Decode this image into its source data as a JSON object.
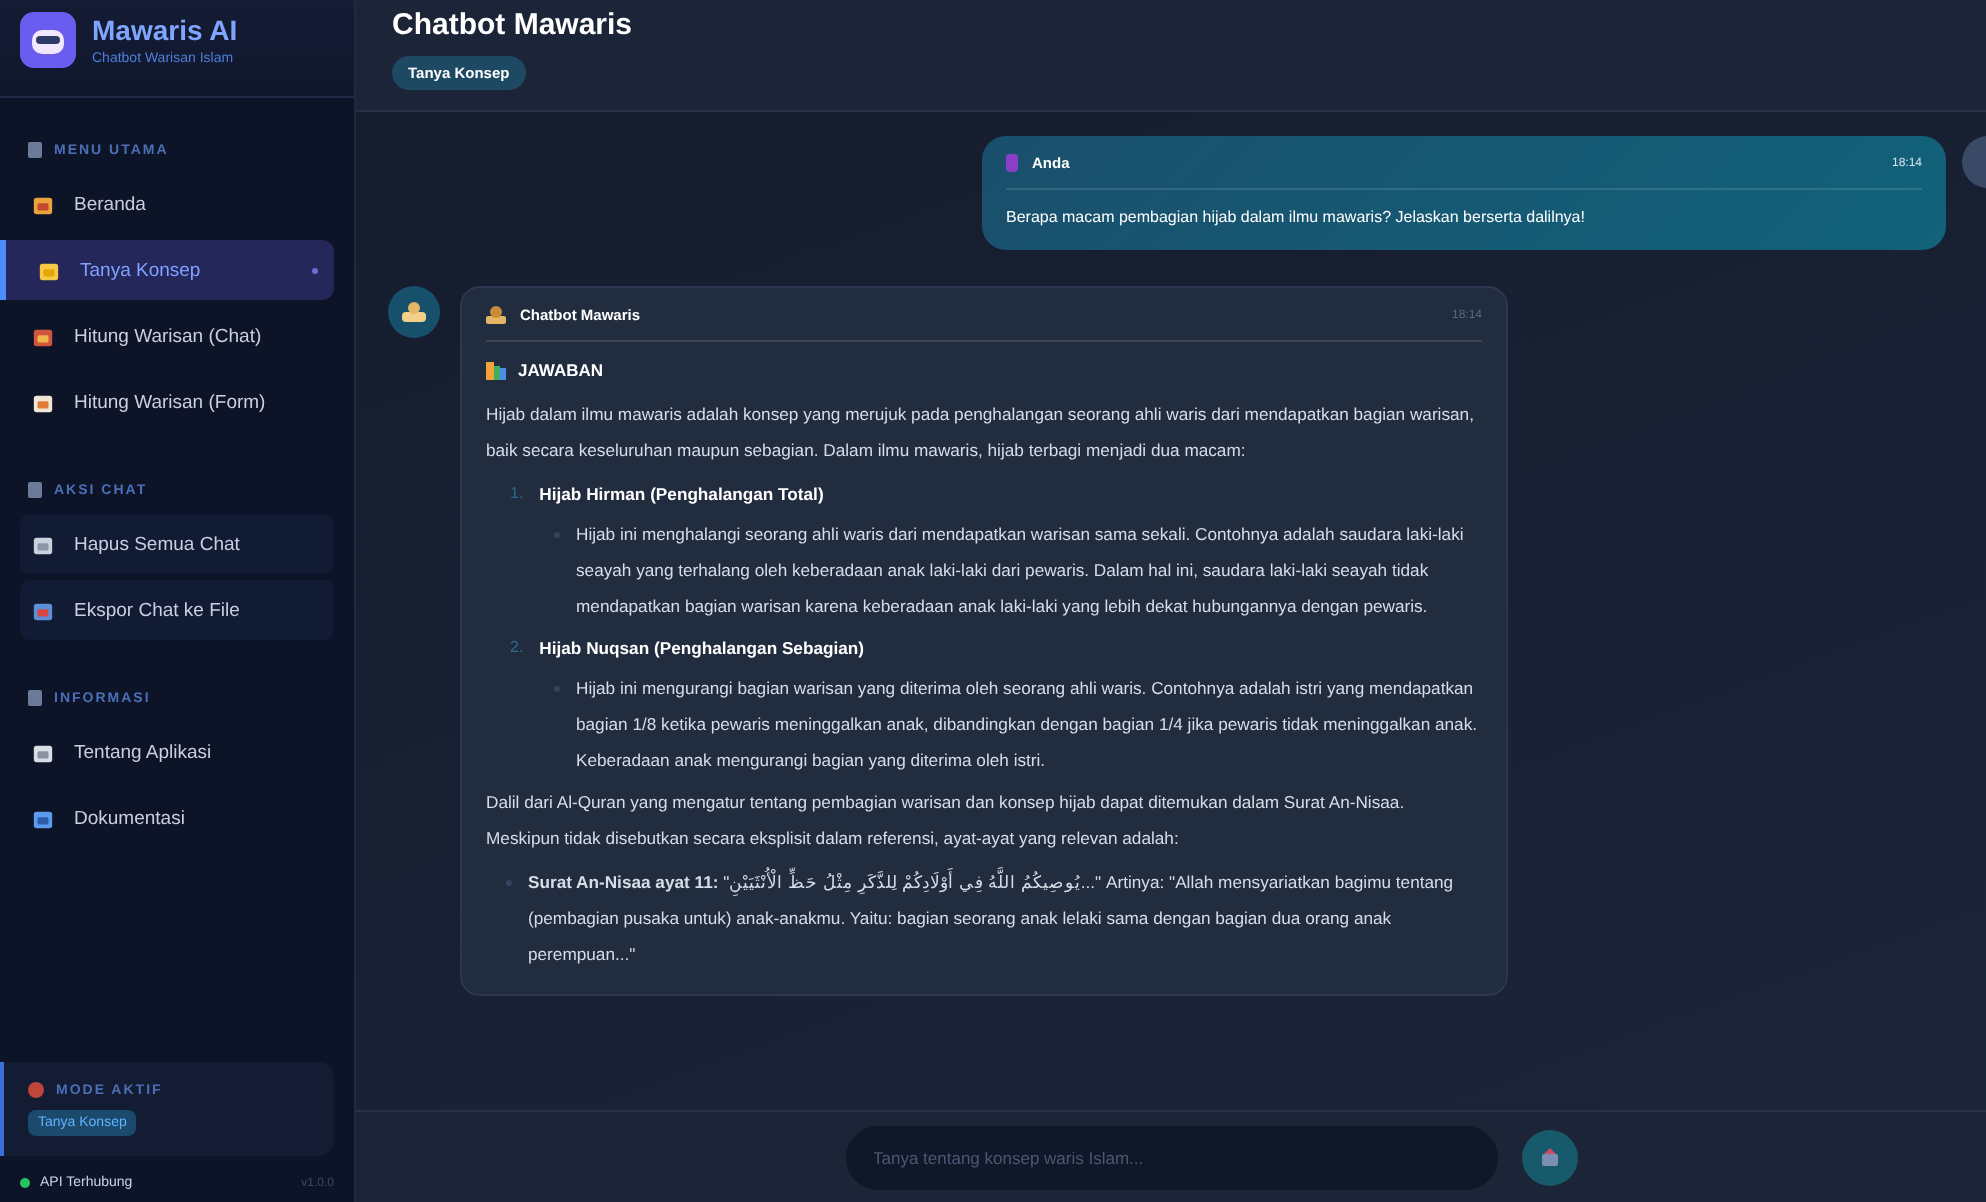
{
  "sidebar": {
    "app_name": "Mawaris AI",
    "app_subtitle": "Chatbot Warisan Islam",
    "sections": [
      {
        "title": "MENU UTAMA",
        "kind": "nav",
        "items": [
          {
            "label": "Beranda",
            "selected": false
          },
          {
            "label": "Tanya Konsep",
            "selected": true
          },
          {
            "label": "Hitung Warisan (Chat)",
            "selected": false
          },
          {
            "label": "Hitung Warisan (Form)",
            "selected": false
          }
        ]
      },
      {
        "title": "AKSI CHAT",
        "kind": "action",
        "items": [
          {
            "label": "Hapus Semua Chat",
            "selected": false
          },
          {
            "label": "Ekspor Chat ke File",
            "selected": false
          }
        ]
      },
      {
        "title": "INFORMASI",
        "kind": "nav",
        "items": [
          {
            "label": "Tentang Aplikasi",
            "selected": false
          },
          {
            "label": "Dokumentasi",
            "selected": false
          }
        ]
      }
    ],
    "mode": {
      "title": "MODE AKTIF",
      "value": "Tanya Konsep"
    },
    "status": {
      "text": "API Terhubung",
      "version": "v1.0.0",
      "connected": true
    }
  },
  "header": {
    "title": "Chatbot Mawaris",
    "badge": "Tanya Konsep"
  },
  "messages": [
    {
      "kind": "user",
      "sender": "Anda",
      "time": "18:14",
      "text": "Berapa macam pembagian hijab dalam ilmu mawaris? Jelaskan berserta dalilnya!"
    },
    {
      "kind": "bot",
      "sender": "Chatbot Mawaris",
      "time": "18:14",
      "heading": "JAWABAN",
      "blocks": [
        {
          "kind": "paragraph",
          "text": "Hijab dalam ilmu mawaris adalah konsep yang merujuk pada penghalangan seorang ahli waris dari mendapatkan bagian warisan, baik secara keseluruhan maupun sebagian. Dalam ilmu mawaris, hijab terbagi menjadi dua macam:"
        },
        {
          "kind": "numbered",
          "number": "1.",
          "title": "Hijab Hirman (Penghalangan Total)",
          "bullets": [
            "Hijab ini menghalangi seorang ahli waris dari mendapatkan warisan sama sekali. Contohnya adalah saudara laki-laki seayah yang terhalang oleh keberadaan anak laki-laki dari pewaris. Dalam hal ini, saudara laki-laki seayah tidak mendapatkan bagian warisan karena keberadaan anak laki-laki yang lebih dekat hubungannya dengan pewaris."
          ]
        },
        {
          "kind": "numbered",
          "number": "2.",
          "title": "Hijab Nuqsan (Penghalangan Sebagian)",
          "bullets": [
            "Hijab ini mengurangi bagian warisan yang diterima oleh seorang ahli waris. Contohnya adalah istri yang mendapatkan bagian 1/8 ketika pewaris meninggalkan anak, dibandingkan dengan bagian 1/4 jika pewaris tidak meninggalkan anak. Keberadaan anak mengurangi bagian yang diterima oleh istri."
          ]
        },
        {
          "kind": "paragraph",
          "text": "Dalil dari Al-Quran yang mengatur tentang pembagian warisan dan konsep hijab dapat ditemukan dalam Surat An-Nisaa. Meskipun tidak disebutkan secara eksplisit dalam referensi, ayat-ayat yang relevan adalah:"
        },
        {
          "kind": "bullet",
          "text": "**Surat An-Nisaa ayat 11:** \"يُوصِيكُمُ اللَّهُ فِي أَوْلَادِكُمْ لِلذَّكَرِ مِثْلُ حَظِّ الْأُنْثَيَيْنِ...\" Artinya: \"Allah mensyariatkan bagimu tentang (pembagian pusaka untuk) anak-anakmu. Yaitu: bagian seorang anak lelaki sama dengan bagian dua orang anak perempuan...\""
        }
      ]
    }
  ],
  "input": {
    "placeholder": "Tanya tentang konsep waris Islam..."
  }
}
